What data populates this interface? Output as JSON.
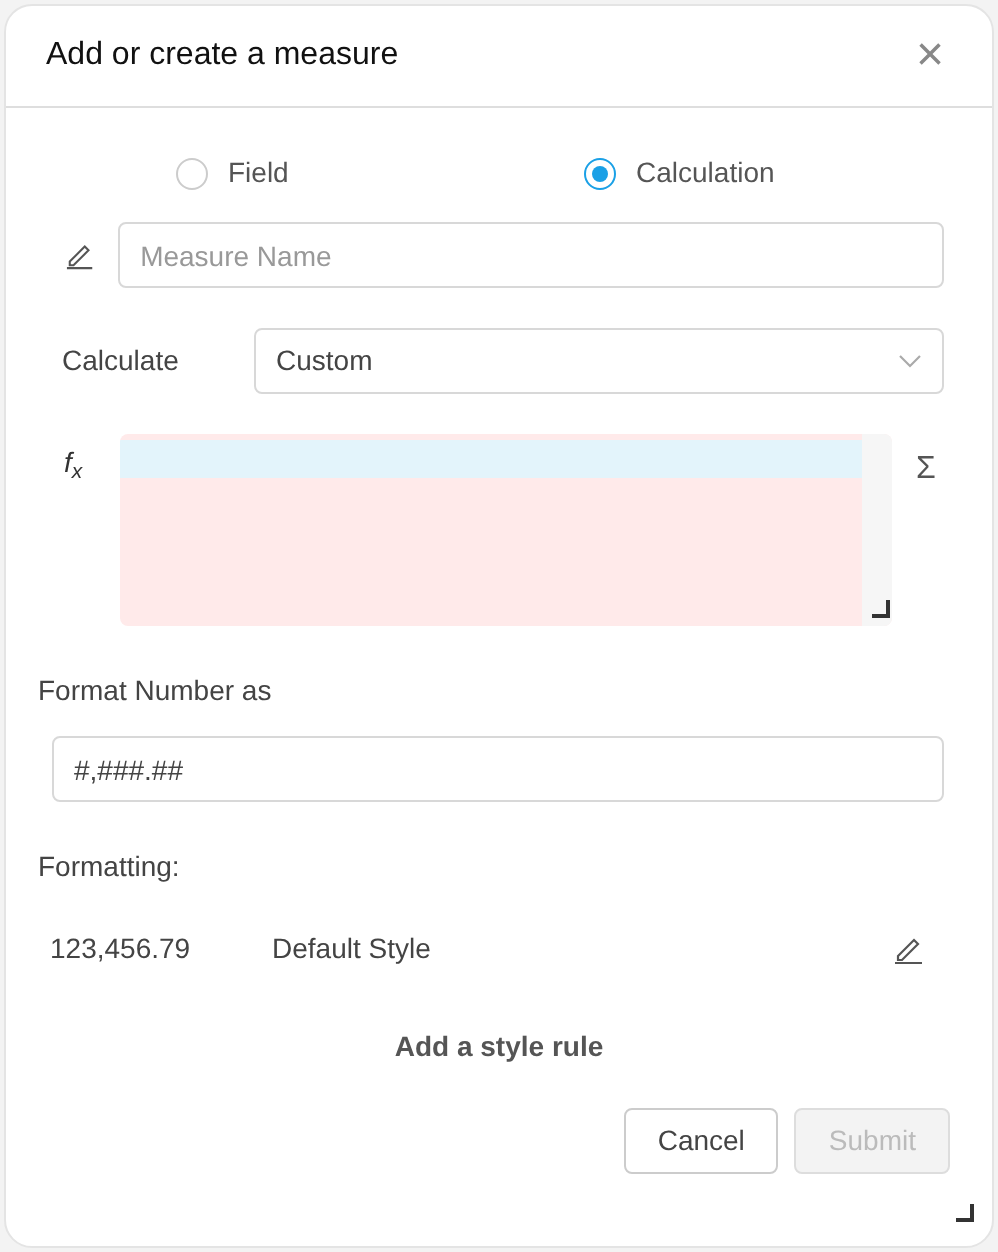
{
  "dialog": {
    "title": "Add or create a measure",
    "close": "×"
  },
  "source_options": [
    {
      "label": "Field",
      "selected": false
    },
    {
      "label": "Calculation",
      "selected": true
    }
  ],
  "measure_name": {
    "placeholder": "Measure Name"
  },
  "calculate": {
    "label": "Calculate",
    "value": "Custom"
  },
  "formula": {
    "icon": "f$_{x}$",
    "sum_icon": "Σ"
  },
  "format_number": {
    "label": "Format Number as",
    "value": "#,###.##"
  },
  "formatting": {
    "label": "Formatting:",
    "rules": [
      {
        "sample": "123,456.79",
        "style": "Default Style"
      }
    ]
  },
  "add_rule": "Add a style rule",
  "buttons": [
    {
      "label": "Cancel",
      "disabled": false
    },
    {
      "label": "Submit",
      "disabled": true
    }
  ]
}
